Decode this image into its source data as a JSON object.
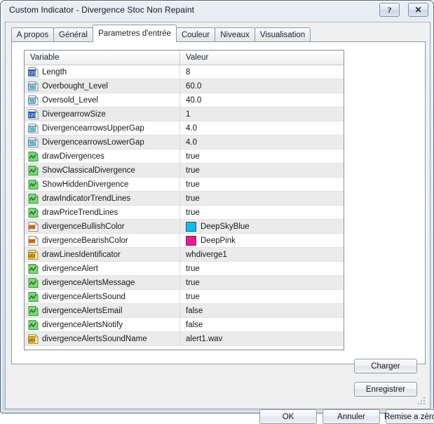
{
  "window": {
    "title": "Custom Indicator - Divergence Stoc Non Repaint",
    "help_glyph": "?",
    "close_glyph": "✕"
  },
  "tabs": [
    {
      "label": "A propos",
      "active": false
    },
    {
      "label": "Général",
      "active": false
    },
    {
      "label": "Parametres d'entrée",
      "active": true
    },
    {
      "label": "Couleur",
      "active": false
    },
    {
      "label": "Niveaux",
      "active": false
    },
    {
      "label": "Visualisation",
      "active": false
    }
  ],
  "grid": {
    "columns": [
      "Variable",
      "Valeur"
    ],
    "rows": [
      {
        "icon": "int-icon",
        "name": "Length",
        "value": "8"
      },
      {
        "icon": "double-icon",
        "name": "Overbought_Level",
        "value": "60.0"
      },
      {
        "icon": "double-icon",
        "name": "Oversold_Level",
        "value": "40.0"
      },
      {
        "icon": "int-icon",
        "name": "DivergearrowSize",
        "value": "1"
      },
      {
        "icon": "double-icon",
        "name": "DivergencearrowsUpperGap",
        "value": "4.0"
      },
      {
        "icon": "double-icon",
        "name": "DivergencearrowsLowerGap",
        "value": "4.0"
      },
      {
        "icon": "bool-icon",
        "name": "drawDivergences",
        "value": "true"
      },
      {
        "icon": "bool-icon",
        "name": "ShowClassicalDivergence",
        "value": "true"
      },
      {
        "icon": "bool-icon",
        "name": "ShowHiddenDivergence",
        "value": "true"
      },
      {
        "icon": "bool-icon",
        "name": "drawIndicatorTrendLines",
        "value": "true"
      },
      {
        "icon": "bool-icon",
        "name": "drawPriceTrendLines",
        "value": "true"
      },
      {
        "icon": "color-icon",
        "name": "divergenceBullishColor",
        "value": "DeepSkyBlue",
        "swatch": "#00BFFF"
      },
      {
        "icon": "color-icon",
        "name": "divergenceBearishColor",
        "value": "DeepPink",
        "swatch": "#FF1493"
      },
      {
        "icon": "string-icon",
        "name": "drawLinesIdentificator",
        "value": "whdiverge1"
      },
      {
        "icon": "bool-icon",
        "name": "divergenceAlert",
        "value": "true"
      },
      {
        "icon": "bool-icon",
        "name": "divergenceAlertsMessage",
        "value": "true"
      },
      {
        "icon": "bool-icon",
        "name": "divergenceAlertsSound",
        "value": "true"
      },
      {
        "icon": "bool-icon",
        "name": "divergenceAlertsEmail",
        "value": "false"
      },
      {
        "icon": "bool-icon",
        "name": "divergenceAlertsNotify",
        "value": "false"
      },
      {
        "icon": "string-icon",
        "name": "divergenceAlertsSoundName",
        "value": "alert1.wav"
      }
    ]
  },
  "buttons": {
    "charger": "Charger",
    "enregistrer": "Enregistrer",
    "ok": "OK",
    "annuler": "Annuler",
    "reset": "Remise a zéro"
  }
}
